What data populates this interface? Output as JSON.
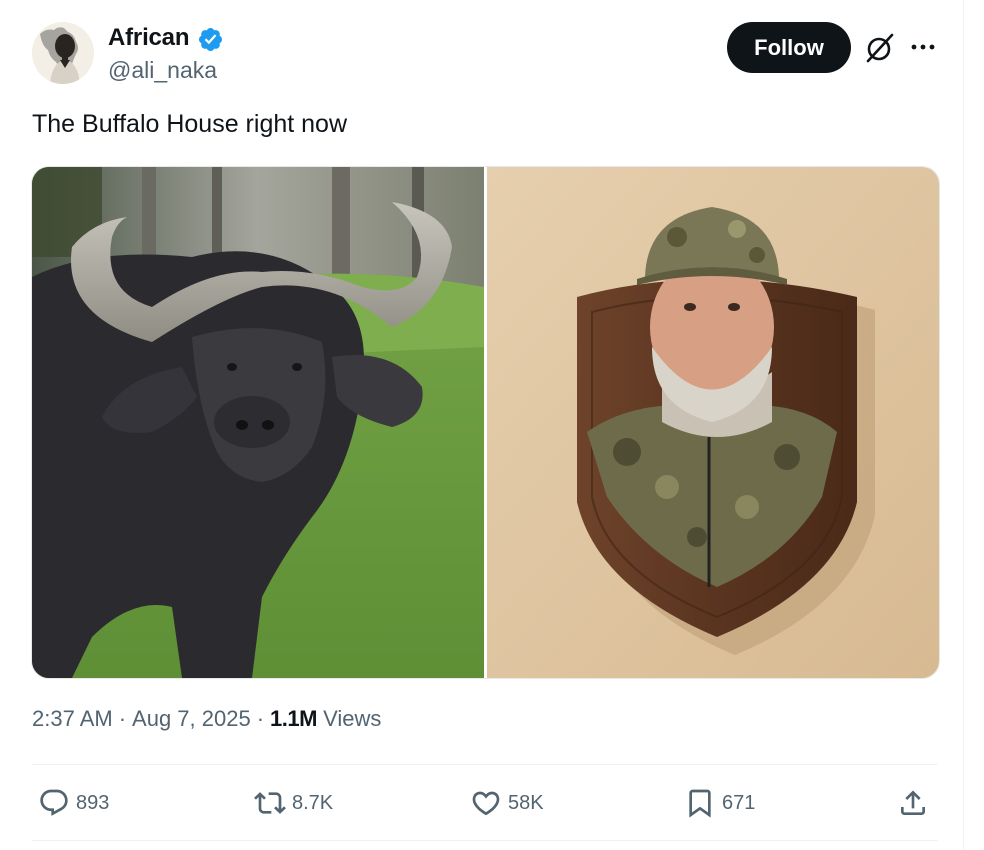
{
  "author": {
    "name": "African",
    "handle": "@ali_naka",
    "verified": true,
    "verified_color": "#1d9bf0"
  },
  "follow_label": "Follow",
  "tweet": {
    "text": "The Buffalo House right now"
  },
  "media": {
    "left_photo": "buffalo-photo",
    "right_photo": "hunter-trophy-mount-photo"
  },
  "meta": {
    "time": "2:37 AM",
    "separator": "·",
    "date": "Aug 7, 2025",
    "views_count": "1.1M",
    "views_label": "Views"
  },
  "actions": {
    "replies": "893",
    "reposts": "8.7K",
    "likes": "58K",
    "bookmarks": "671"
  },
  "icons": [
    "verified-badge-icon",
    "grok-icon",
    "more-icon",
    "reply-icon",
    "repost-icon",
    "like-icon",
    "bookmark-icon",
    "share-icon"
  ],
  "colors": {
    "text_primary": "#0f1419",
    "text_secondary": "#536471",
    "button_bg": "#0f1419",
    "divider": "#eff3f4"
  }
}
